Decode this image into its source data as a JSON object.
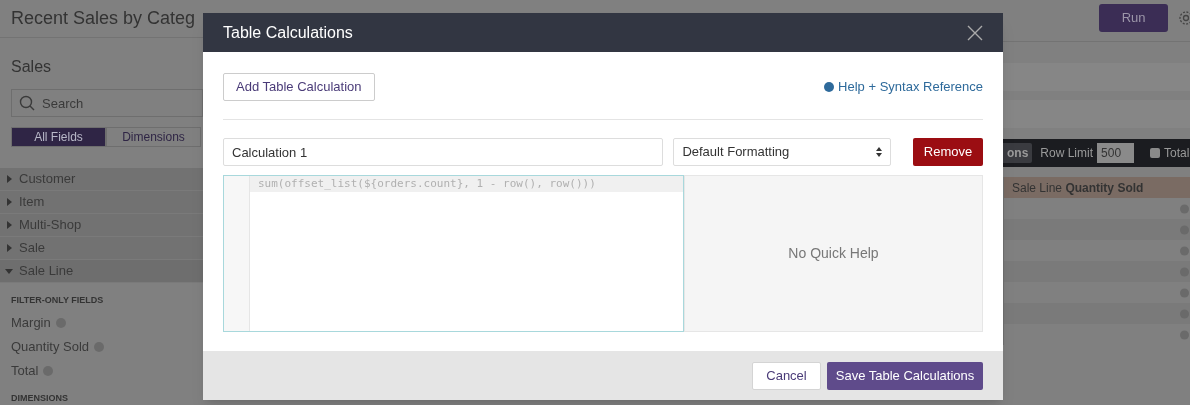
{
  "page_title": "Recent Sales by Categ",
  "run_button": "Run",
  "sidebar": {
    "title": "Sales",
    "search": {
      "placeholder": "Search"
    },
    "tabs": [
      {
        "label": "All Fields",
        "selected": true
      },
      {
        "label": "Dimensions",
        "selected": false
      }
    ],
    "groups": [
      {
        "label": "Customer",
        "expanded": false
      },
      {
        "label": "Item",
        "expanded": false
      },
      {
        "label": "Multi-Shop",
        "expanded": false
      },
      {
        "label": "Sale",
        "expanded": false
      },
      {
        "label": "Sale Line",
        "expanded": true
      }
    ],
    "filter_only_heading": "FILTER-ONLY FIELDS",
    "filter_only_fields": [
      "Margin",
      "Quantity Sold",
      "Total"
    ],
    "dimensions_heading": "DIMENSIONS"
  },
  "results_toolbar": {
    "button": "ons",
    "row_limit_label": "Row Limit",
    "row_limit": "500",
    "totals": {
      "label": "Total",
      "checked": false
    }
  },
  "results_table": {
    "column_header": "Sale Line **Quantity Sold**"
  },
  "modal": {
    "title": "Table Calculations",
    "add_button": "Add Table Calculation",
    "help_link": "Help + Syntax Reference",
    "name_field": {
      "value": "Calculation 1"
    },
    "format_select": {
      "value": "Default Formatting"
    },
    "remove_button": "Remove",
    "code": "sum(offset_list(${orders.count}, 1 - row(), row()))",
    "quick_help": "No Quick Help",
    "cancel_button": "Cancel",
    "save_button": "Save Table Calculations"
  }
}
